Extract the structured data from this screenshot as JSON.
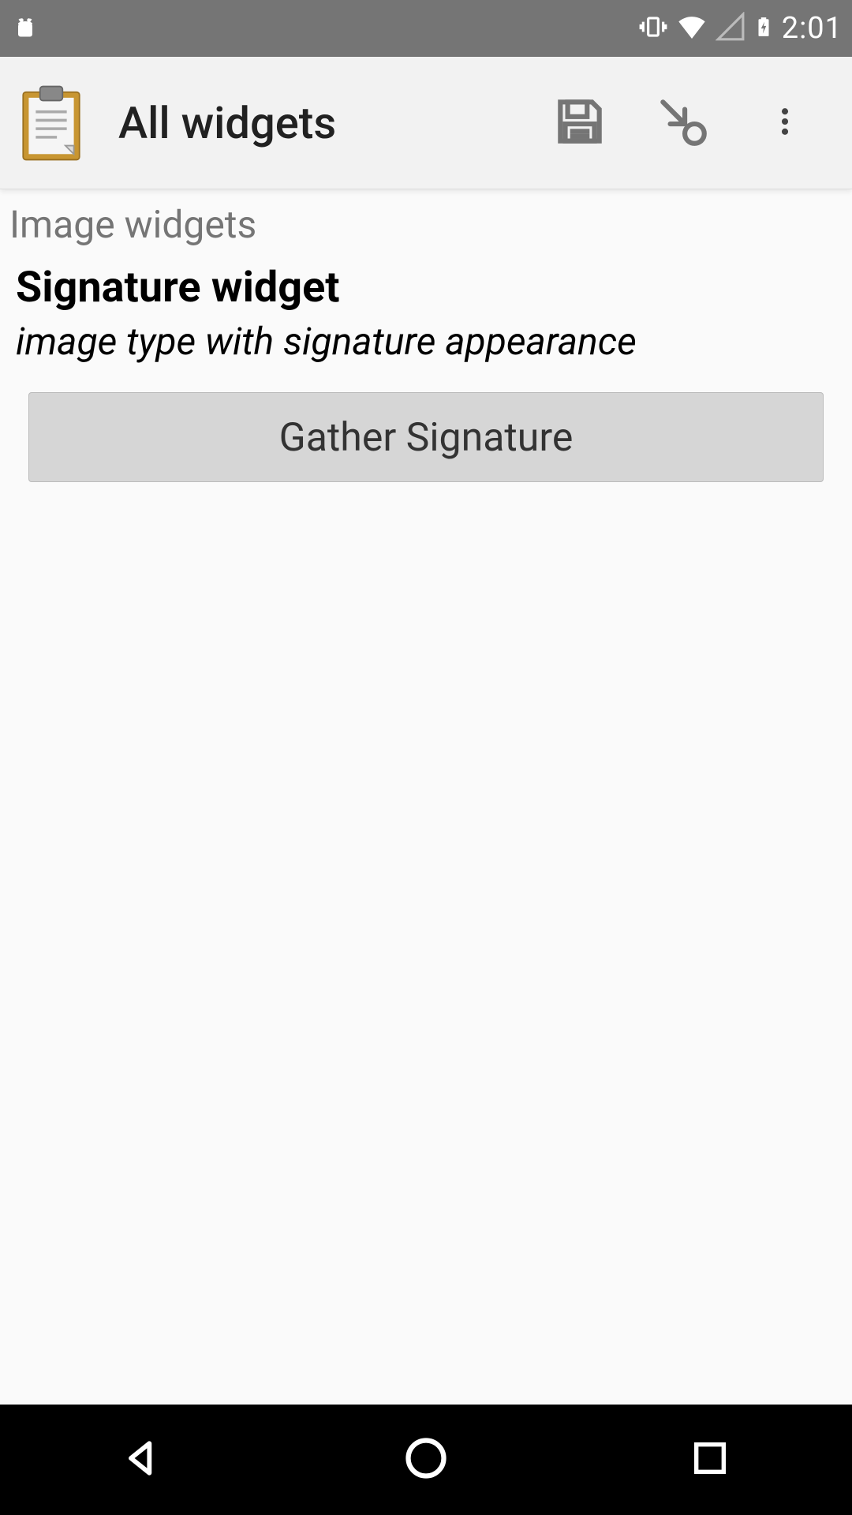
{
  "status_bar": {
    "time": "2:01"
  },
  "app_bar": {
    "title": "All widgets"
  },
  "content": {
    "section_header": "Image widgets",
    "widget_title": "Signature widget",
    "widget_subtitle": "image type with signature appearance",
    "gather_button_label": "Gather Signature"
  },
  "icons": {
    "clipboard": "clipboard-icon",
    "save": "save-icon",
    "goto": "arrow-circle-icon",
    "overflow": "more-vert-icon",
    "android": "android-debug-icon",
    "vibrate": "vibrate-icon",
    "wifi": "wifi-icon",
    "cell": "cell-signal-icon",
    "battery": "battery-charging-icon",
    "back": "back-icon",
    "home": "home-icon",
    "recent": "recent-icon"
  }
}
